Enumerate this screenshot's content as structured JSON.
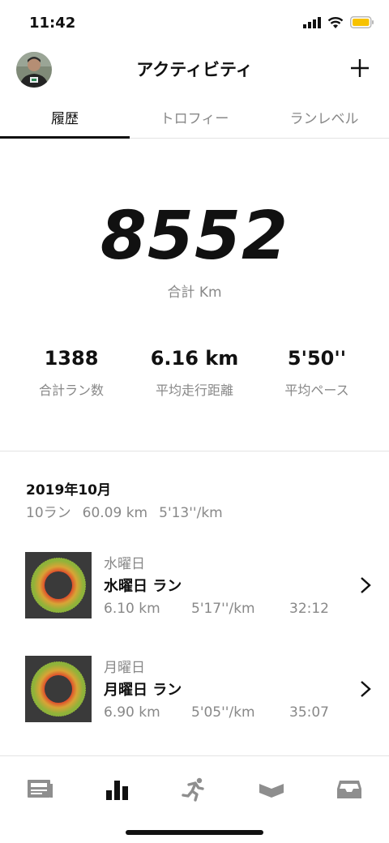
{
  "status": {
    "time": "11:42"
  },
  "header": {
    "title": "アクティビティ"
  },
  "tabs": [
    {
      "label": "履歴",
      "active": true
    },
    {
      "label": "トロフィー",
      "active": false
    },
    {
      "label": "ランレベル",
      "active": false
    }
  ],
  "summary": {
    "total_distance": "8552",
    "total_label": "合計 Km",
    "stats": [
      {
        "value": "1388",
        "label": "合計ラン数"
      },
      {
        "value": "6.16 km",
        "label": "平均走行距離"
      },
      {
        "value": "5'50''",
        "label": "平均ペース"
      }
    ]
  },
  "month": {
    "title": "2019年10月",
    "runs": "10ラン",
    "distance": "60.09 km",
    "pace": "5'13''/km"
  },
  "runs": [
    {
      "day": "水曜日",
      "name": "水曜日 ラン",
      "distance": "6.10 km",
      "pace": "5'17''/km",
      "time": "32:12"
    },
    {
      "day": "月曜日",
      "name": "月曜日 ラン",
      "distance": "6.90 km",
      "pace": "5'05''/km",
      "time": "35:07"
    }
  ],
  "colors": {
    "battery": "#f7c200",
    "ring_outer": "#8fb33a",
    "ring_inner": "#e0442a",
    "thumb_bg": "#3a3a3a"
  }
}
